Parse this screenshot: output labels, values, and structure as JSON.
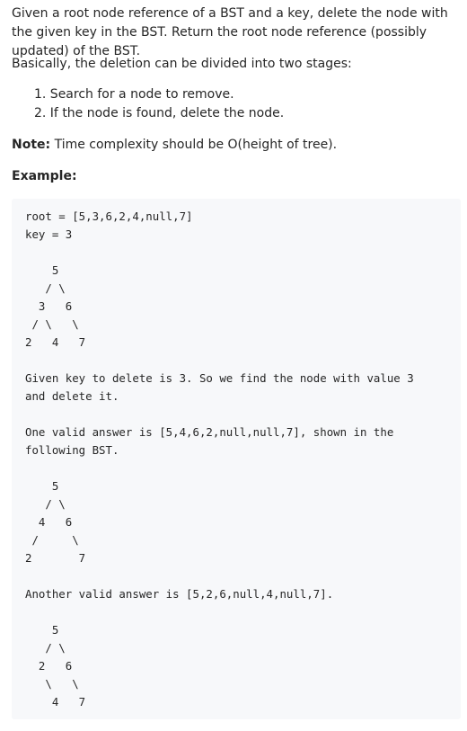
{
  "intro": "Given a root node reference of a BST and a key, delete the node with the given key in the BST. Return the root node reference (possibly updated) of the BST.",
  "stages_intro": "Basically, the deletion can be divided into two stages:",
  "steps": [
    "1. Search for a node to remove.",
    "2. If the node is found, delete the node."
  ],
  "note_label": "Note:",
  "note_text": " Time complexity should be O(height of tree).",
  "example_label": "Example:",
  "code": "root = [5,3,6,2,4,null,7]\nkey = 3\n\n    5\n   / \\\n  3   6\n / \\   \\\n2   4   7\n\nGiven key to delete is 3. So we find the node with value 3\nand delete it.\n\nOne valid answer is [5,4,6,2,null,null,7], shown in the\nfollowing BST.\n\n    5\n   / \\\n  4   6\n /     \\\n2       7\n\nAnother valid answer is [5,2,6,null,4,null,7].\n\n    5\n   / \\\n  2   6\n   \\   \\\n    4   7"
}
